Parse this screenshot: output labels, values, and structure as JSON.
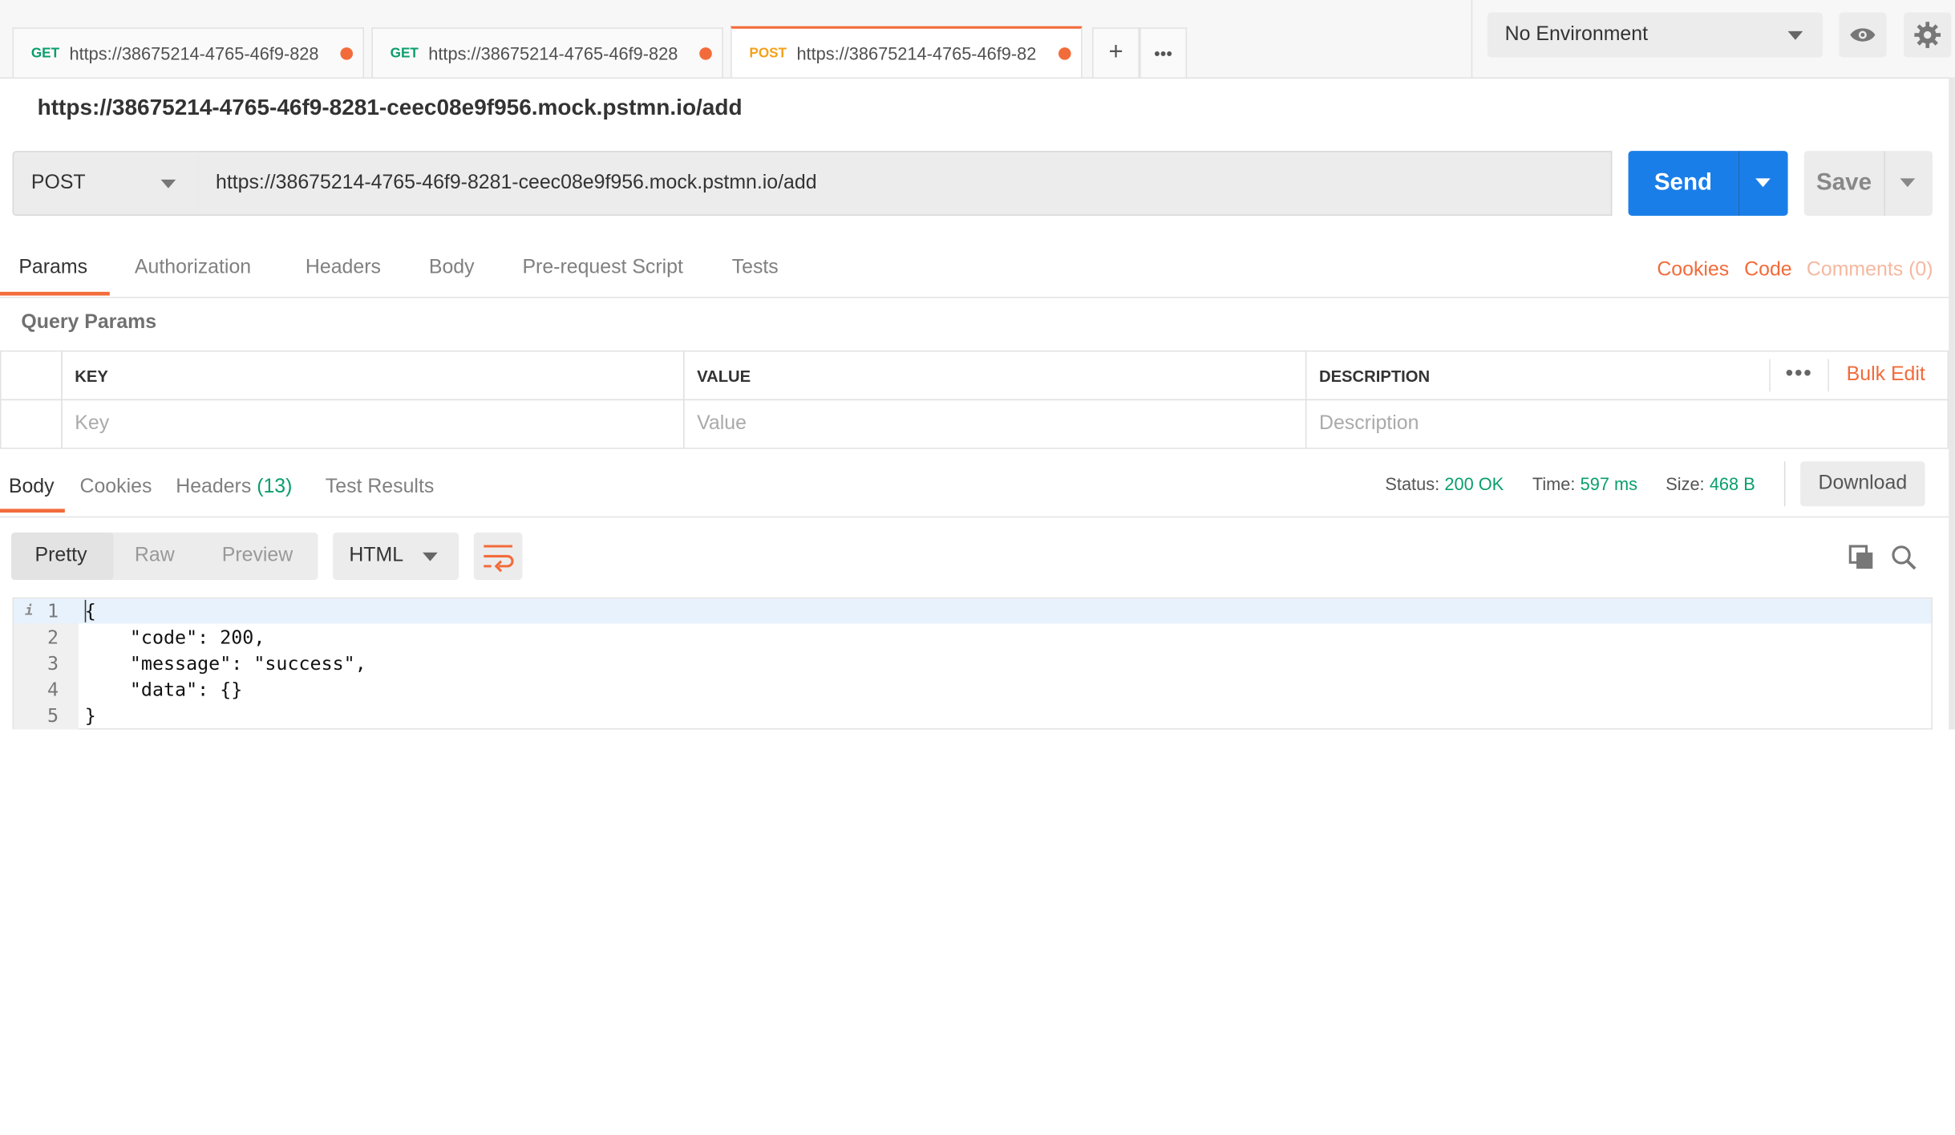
{
  "tabs": [
    {
      "method": "GET",
      "url": "https://38675214-4765-46f9-828"
    },
    {
      "method": "GET",
      "url": "https://38675214-4765-46f9-828"
    },
    {
      "method": "POST",
      "url": "https://38675214-4765-46f9-82"
    }
  ],
  "tabbar": {
    "add": "+",
    "more": "•••"
  },
  "environment": {
    "selected": "No Environment"
  },
  "request": {
    "title": "https://38675214-4765-46f9-8281-ceec08e9f956.mock.pstmn.io/add",
    "method": "POST",
    "url": "https://38675214-4765-46f9-8281-ceec08e9f956.mock.pstmn.io/add",
    "send_label": "Send",
    "save_label": "Save"
  },
  "request_tabs": [
    "Params",
    "Authorization",
    "Headers",
    "Body",
    "Pre-request Script",
    "Tests"
  ],
  "request_links": {
    "cookies": "Cookies",
    "code": "Code",
    "comments": "Comments (0)"
  },
  "query_params": {
    "title": "Query Params",
    "headers": {
      "key": "KEY",
      "value": "VALUE",
      "description": "DESCRIPTION"
    },
    "placeholders": {
      "key": "Key",
      "value": "Value",
      "description": "Description"
    },
    "more": "•••",
    "bulk_edit": "Bulk Edit"
  },
  "response": {
    "tabs": {
      "body": "Body",
      "cookies": "Cookies",
      "headers": "Headers",
      "headers_count": "(13)",
      "tests": "Test Results"
    },
    "status_label": "Status:",
    "status": "200 OK",
    "time_label": "Time:",
    "time": "597 ms",
    "size_label": "Size:",
    "size": "468 B",
    "download": "Download",
    "view_modes": [
      "Pretty",
      "Raw",
      "Preview"
    ],
    "format": "HTML",
    "body_lines": [
      {
        "n": "1",
        "text": "{"
      },
      {
        "n": "2",
        "text": "    \"code\": 200,"
      },
      {
        "n": "3",
        "text": "    \"message\": \"success\","
      },
      {
        "n": "4",
        "text": "    \"data\": {}"
      },
      {
        "n": "5",
        "text": "}"
      }
    ]
  },
  "colors": {
    "accent": "#f26b3a",
    "primary": "#1a7ee8",
    "success": "#0a9e6c",
    "get": "#0a9e6c",
    "post": "#f4a11a"
  }
}
